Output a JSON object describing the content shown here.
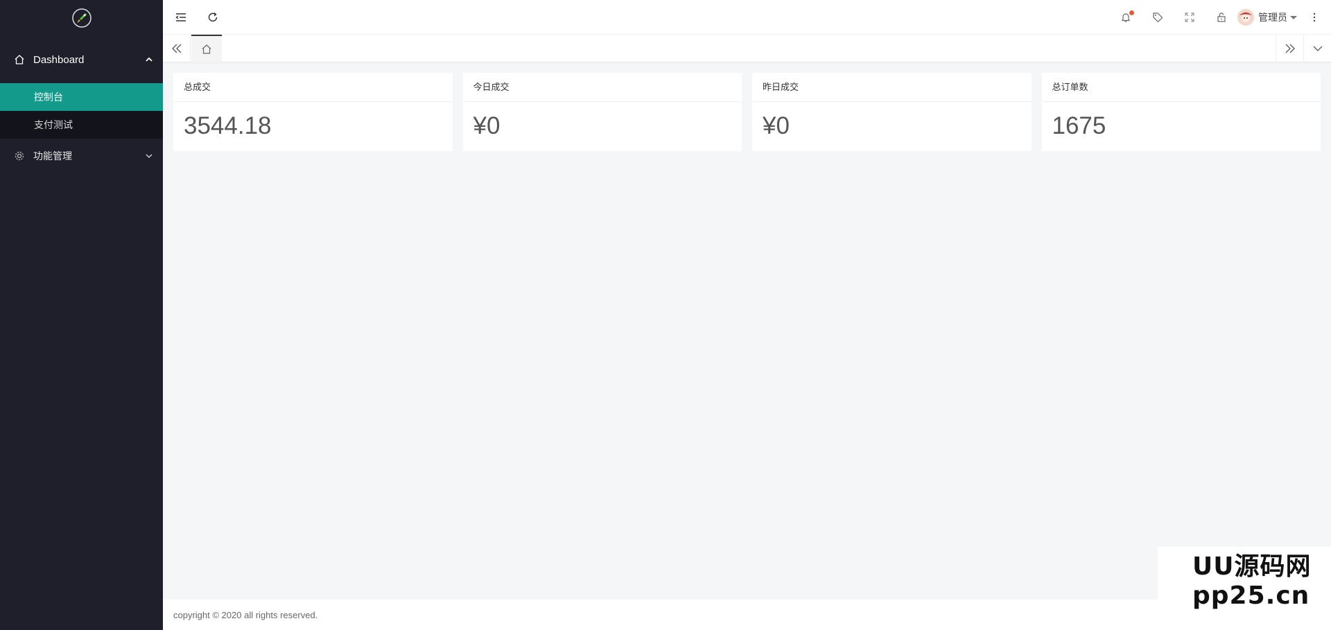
{
  "sidebar": {
    "logo_icon": "rocket-logo",
    "groups": [
      {
        "label": "Dashboard",
        "icon": "home-icon",
        "expanded": true,
        "items": [
          {
            "label": "控制台",
            "active": true
          },
          {
            "label": "支付测试",
            "active": false
          }
        ]
      },
      {
        "label": "功能管理",
        "icon": "gear-icon",
        "expanded": false
      }
    ],
    "accent_color": "#139a8a",
    "background": "#1f1f2b"
  },
  "header": {
    "left_icons": [
      "collapse-menu-icon",
      "refresh-icon"
    ],
    "right_icons": [
      "bell-icon",
      "tag-icon",
      "fullscreen-icon",
      "lock-icon"
    ],
    "user_name": "管理员"
  },
  "tabs": {
    "home_icon": "home-icon"
  },
  "stats": [
    {
      "title": "总成交",
      "value": "3544.18"
    },
    {
      "title": "今日成交",
      "value": "¥0"
    },
    {
      "title": "昨日成交",
      "value": "¥0"
    },
    {
      "title": "总订单数",
      "value": "1675"
    }
  ],
  "footer": {
    "copyright": "copyright © 2020 all rights reserved."
  },
  "watermark": {
    "line1": "UU源码网",
    "line2": "pp25.cn"
  }
}
